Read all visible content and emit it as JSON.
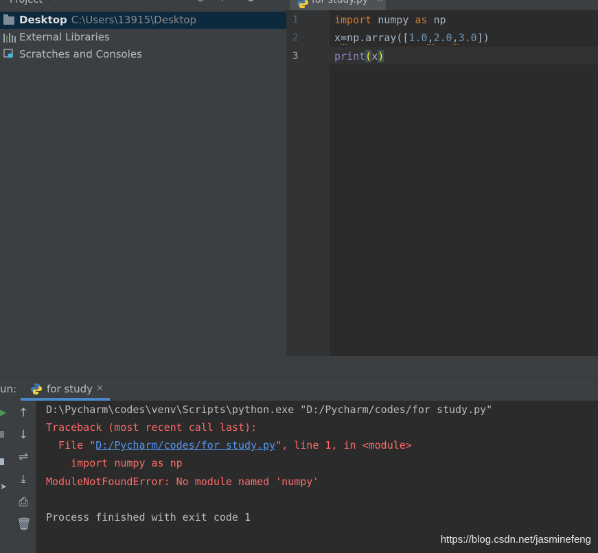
{
  "project": {
    "title": "Project",
    "tree": [
      {
        "label": "Desktop",
        "path": "C:\\Users\\13915\\Desktop",
        "icon": "folder-icon"
      },
      {
        "label": "External Libraries",
        "icon": "library-icon"
      },
      {
        "label": "Scratches and Consoles",
        "icon": "scratches-icon"
      }
    ]
  },
  "editor": {
    "tab_label": "for study.py",
    "line_numbers": [
      "1",
      "2",
      "3"
    ],
    "code": {
      "l1_kw_import": "import",
      "l1_mod": " numpy ",
      "l1_kw_as": "as",
      "l1_alias": " np",
      "l2_a": "x",
      "l2_eq": "=",
      "l2_b": "np.array([",
      "l2_n1": "1.0",
      "l2_c1": ",",
      "l2_n2": "2.0",
      "l2_c2": ",",
      "l2_n3": "3.0",
      "l2_end": "])",
      "l3_print": "print",
      "l3_open": "(",
      "l3_x": "x",
      "l3_close": ")"
    }
  },
  "run": {
    "label": "un:",
    "tab_label": "for study",
    "console": {
      "cmd": "D:\\Pycharm\\codes\\venv\\Scripts\\python.exe \"D:/Pycharm/codes/for study.py\"",
      "traceback": "Traceback (most recent call last):",
      "file_prefix": "  File \"",
      "file_link": "D:/Pycharm/codes/for study.py",
      "file_suffix": "\", line 1, in <module>",
      "code_line": "    import numpy as np",
      "error": "ModuleNotFoundError: No module named 'numpy'",
      "exit": "Process finished with exit code 1"
    }
  },
  "watermark": "https://blog.csdn.net/jasminefeng",
  "colors": {
    "background": "#2b2b2b",
    "panel": "#3c3f41",
    "keyword": "#cc7832",
    "number": "#6897bb",
    "error": "#ff6b68",
    "link": "#5394ec",
    "selection": "#0d293e"
  }
}
